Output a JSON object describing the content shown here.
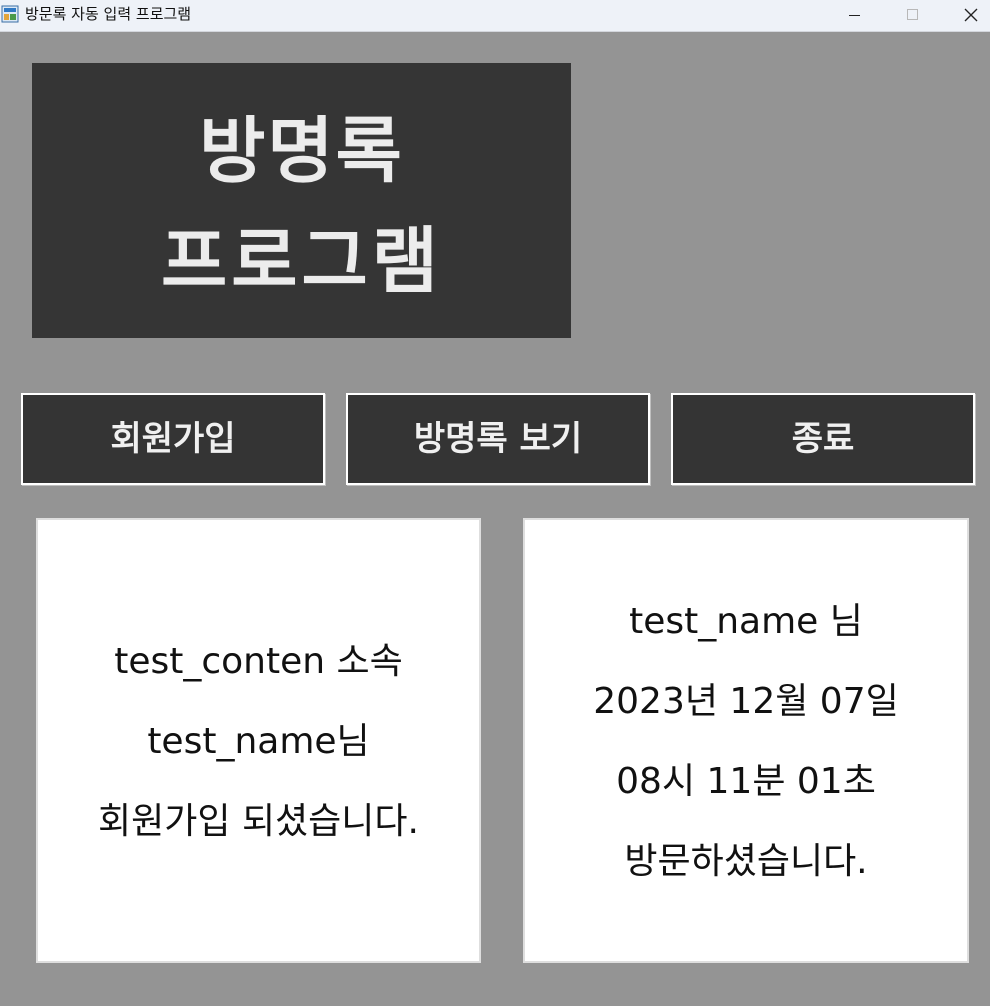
{
  "window": {
    "title": "방문록 자동 입력 프로그램",
    "icon": "app-icon"
  },
  "banner": {
    "line1": "방명록",
    "line2": "프로그램"
  },
  "buttons": {
    "signup": "회원가입",
    "view": "방명록 보기",
    "exit": "종료"
  },
  "signup_message": {
    "line1": "test_conten 소속",
    "line2": "test_name님",
    "line3": "회원가입 되셨습니다."
  },
  "visit_message": {
    "line1": "test_name 님",
    "line2": "2023년 12월 07일",
    "line3": "08시 11분 01초",
    "line4": "방문하셨습니다."
  },
  "colors": {
    "background": "#949494",
    "panel": "#353535",
    "button": "#343434",
    "text_light": "#ececec",
    "message_bg": "#ffffff"
  }
}
